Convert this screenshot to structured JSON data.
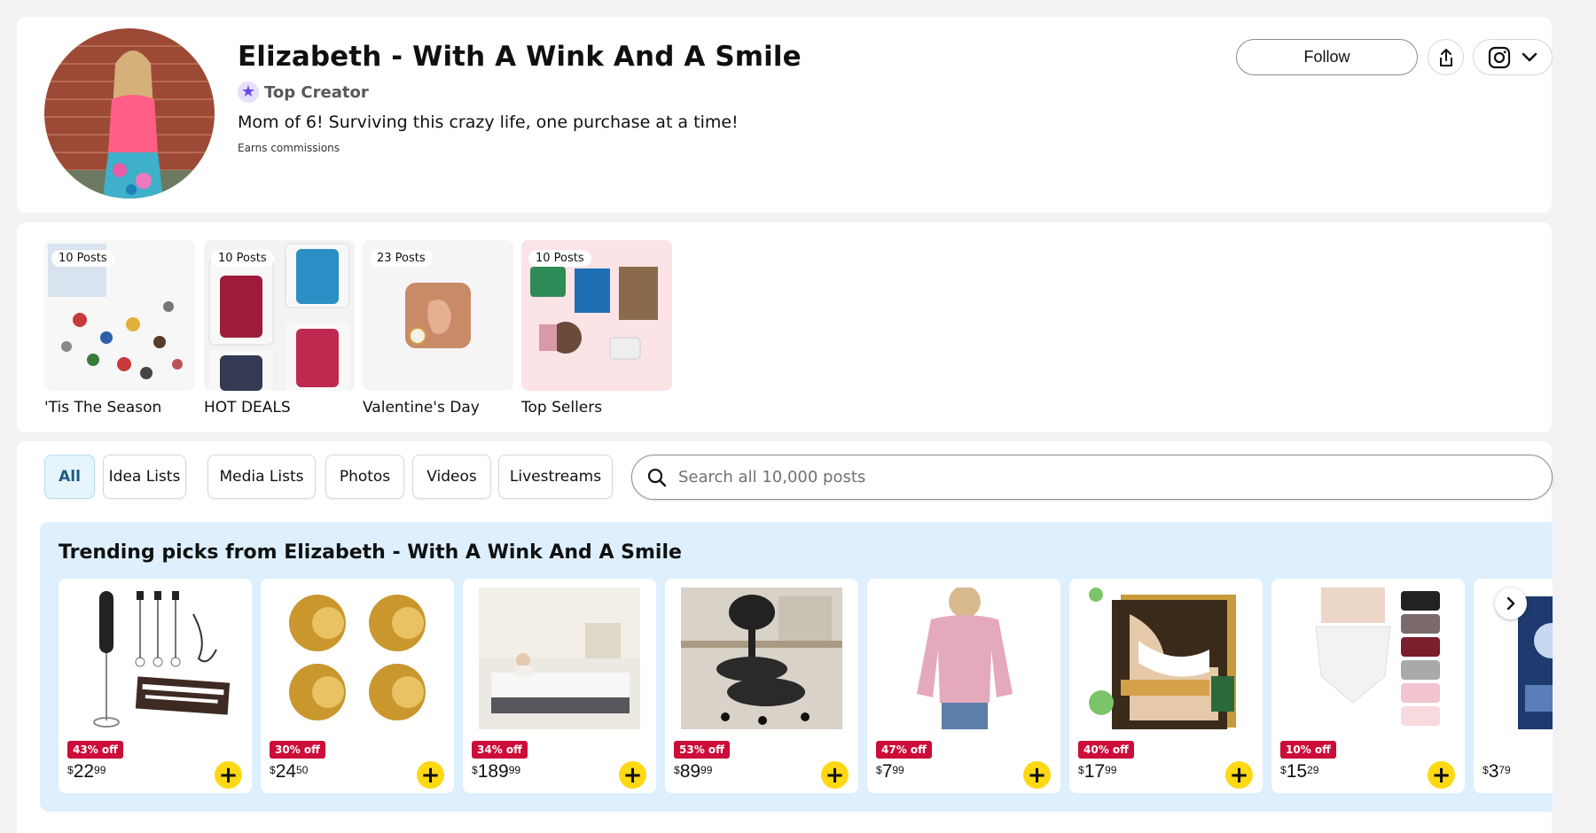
{
  "profile": {
    "name": "Elizabeth - With A Wink And A Smile",
    "badge": "Top Creator",
    "bio": "Mom of 6! Surviving this crazy life, one purchase at a time!",
    "commission_note": "Earns commissions",
    "follow_label": "Follow",
    "icons": [
      "share-icon",
      "instagram-icon",
      "chevron-down-icon"
    ]
  },
  "collections": [
    {
      "name": "'Tis The Season",
      "count": "10 Posts"
    },
    {
      "name": "HOT DEALS",
      "count": "10 Posts"
    },
    {
      "name": "Valentine's Day",
      "count": "23 Posts"
    },
    {
      "name": "Top Sellers",
      "count": "10 Posts"
    }
  ],
  "filters": {
    "tabs": [
      "All",
      "Idea Lists",
      "Media Lists",
      "Photos",
      "Videos",
      "Livestreams"
    ],
    "active": "All",
    "search_placeholder": "Search all 10,000 posts"
  },
  "trending": {
    "title": "Trending picks from Elizabeth - With A Wink And A Smile",
    "products": [
      {
        "deal": "43% off",
        "currency": "$",
        "dollars": "22",
        "cents": "99"
      },
      {
        "deal": "30% off",
        "currency": "$",
        "dollars": "24",
        "cents": "50"
      },
      {
        "deal": "34% off",
        "currency": "$",
        "dollars": "189",
        "cents": "99"
      },
      {
        "deal": "53% off",
        "currency": "$",
        "dollars": "89",
        "cents": "99"
      },
      {
        "deal": "47% off",
        "currency": "$",
        "dollars": "7",
        "cents": "99"
      },
      {
        "deal": "40% off",
        "currency": "$",
        "dollars": "17",
        "cents": "99"
      },
      {
        "deal": "10% off",
        "currency": "$",
        "dollars": "15",
        "cents": "29"
      },
      {
        "deal": "",
        "currency": "$",
        "dollars": "3",
        "cents": "79"
      }
    ]
  },
  "colors": {
    "deal_badge": "#cc0c39",
    "add_button": "#ffd814",
    "trending_bg": "#deeffd",
    "active_tab_bg": "#e6f4fb"
  }
}
